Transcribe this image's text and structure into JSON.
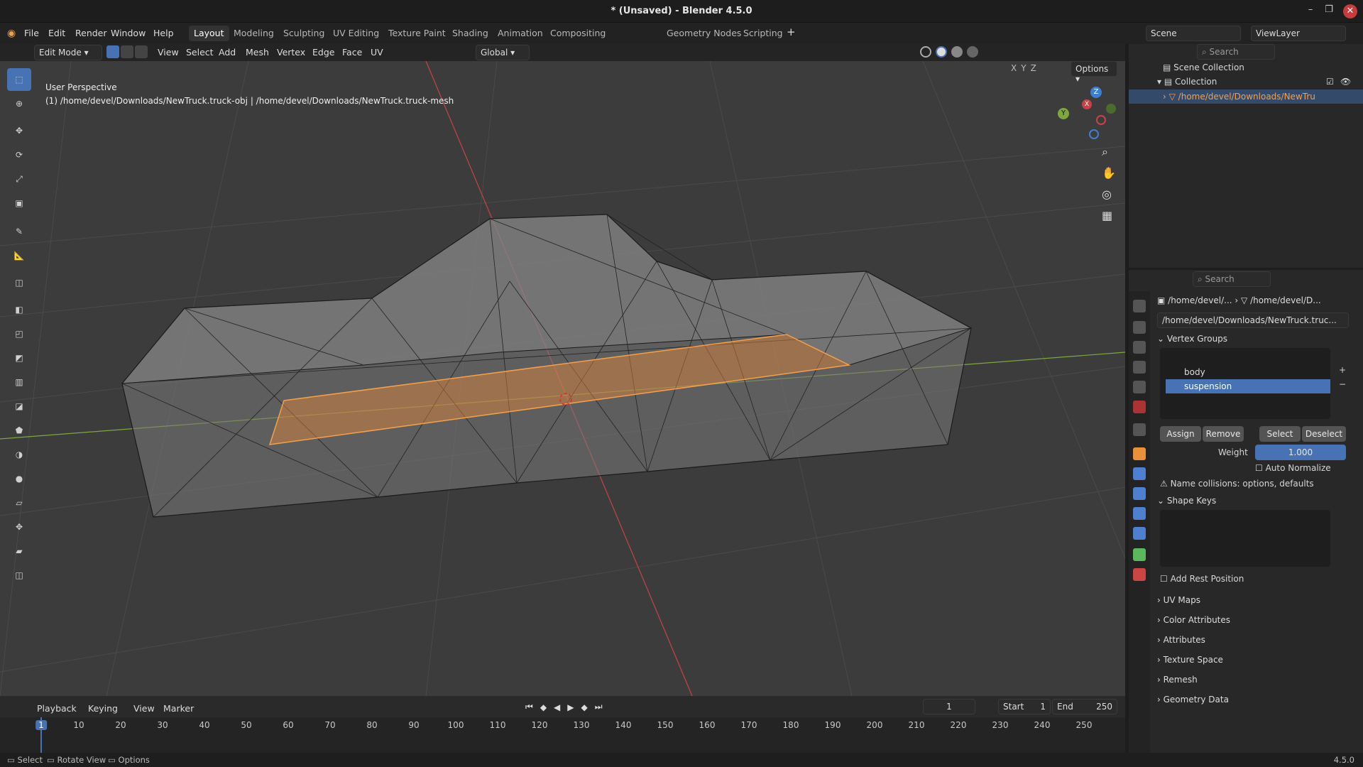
{
  "app": {
    "title": "* (Unsaved) - Blender 4.5.0"
  },
  "menus": [
    "File",
    "Edit",
    "Render",
    "Window",
    "Help"
  ],
  "workspaces": [
    "Layout",
    "Modeling",
    "Sculpting",
    "UV Editing",
    "Texture Paint",
    "Shading",
    "Animation",
    "Compositing",
    "Geometry Nodes",
    "Scripting"
  ],
  "scene": {
    "name": "Scene",
    "view_layer": "ViewLayer"
  },
  "viewport": {
    "mode": "Edit Mode",
    "menus": [
      "View",
      "Select",
      "Add",
      "Mesh",
      "Vertex",
      "Edge",
      "Face",
      "UV"
    ],
    "orientation": "Global",
    "options_label": "Options",
    "axes": [
      "X",
      "Y",
      "Z"
    ],
    "perspective_label": "User Perspective",
    "object_label": "(1) /home/devel/Downloads/NewTruck.truck-obj | /home/devel/Downloads/NewTruck.truck-mesh"
  },
  "outliner": {
    "search_placeholder": "Search",
    "scene_collection": "Scene Collection",
    "collection": "Collection",
    "object": "/home/devel/Downloads/NewTru"
  },
  "properties": {
    "search_placeholder": "Search",
    "breadcrumb_obj": "/home/devel/...",
    "breadcrumb_mesh": "/home/devel/D...",
    "mesh_name": "/home/devel/Downloads/NewTruck.truc...",
    "vertex_groups": {
      "title": "Vertex Groups",
      "items": [
        "body",
        "suspension"
      ],
      "selected": "suspension"
    },
    "buttons": {
      "assign": "Assign",
      "remove": "Remove",
      "select": "Select",
      "deselect": "Deselect"
    },
    "weight_label": "Weight",
    "weight_value": "1.000",
    "auto_normalize": "Auto Normalize",
    "warning": "Name collisions: options, defaults",
    "shape_keys": "Shape Keys",
    "add_rest_position": "Add Rest Position",
    "collapsed": [
      "UV Maps",
      "Color Attributes",
      "Attributes",
      "Texture Space",
      "Remesh",
      "Geometry Data"
    ]
  },
  "timeline": {
    "menus": [
      "Playback",
      "Keying",
      "View",
      "Marker"
    ],
    "current_frame": "1",
    "start_label": "Start",
    "start": "1",
    "end_label": "End",
    "end": "250",
    "ticks": [
      "1",
      "10",
      "20",
      "30",
      "40",
      "50",
      "60",
      "70",
      "80",
      "90",
      "100",
      "110",
      "120",
      "130",
      "140",
      "150",
      "160",
      "170",
      "180",
      "190",
      "200",
      "210",
      "220",
      "230",
      "240",
      "250"
    ]
  },
  "status": {
    "select": "Select",
    "rotate": "Rotate View",
    "options": "Options",
    "version": "4.5.0"
  },
  "colors": {
    "accent": "#4772b3",
    "selection": "#f5a04b",
    "x_axis": "#c8424a",
    "y_axis": "#7ea73f",
    "z_axis": "#3f7fd1"
  }
}
